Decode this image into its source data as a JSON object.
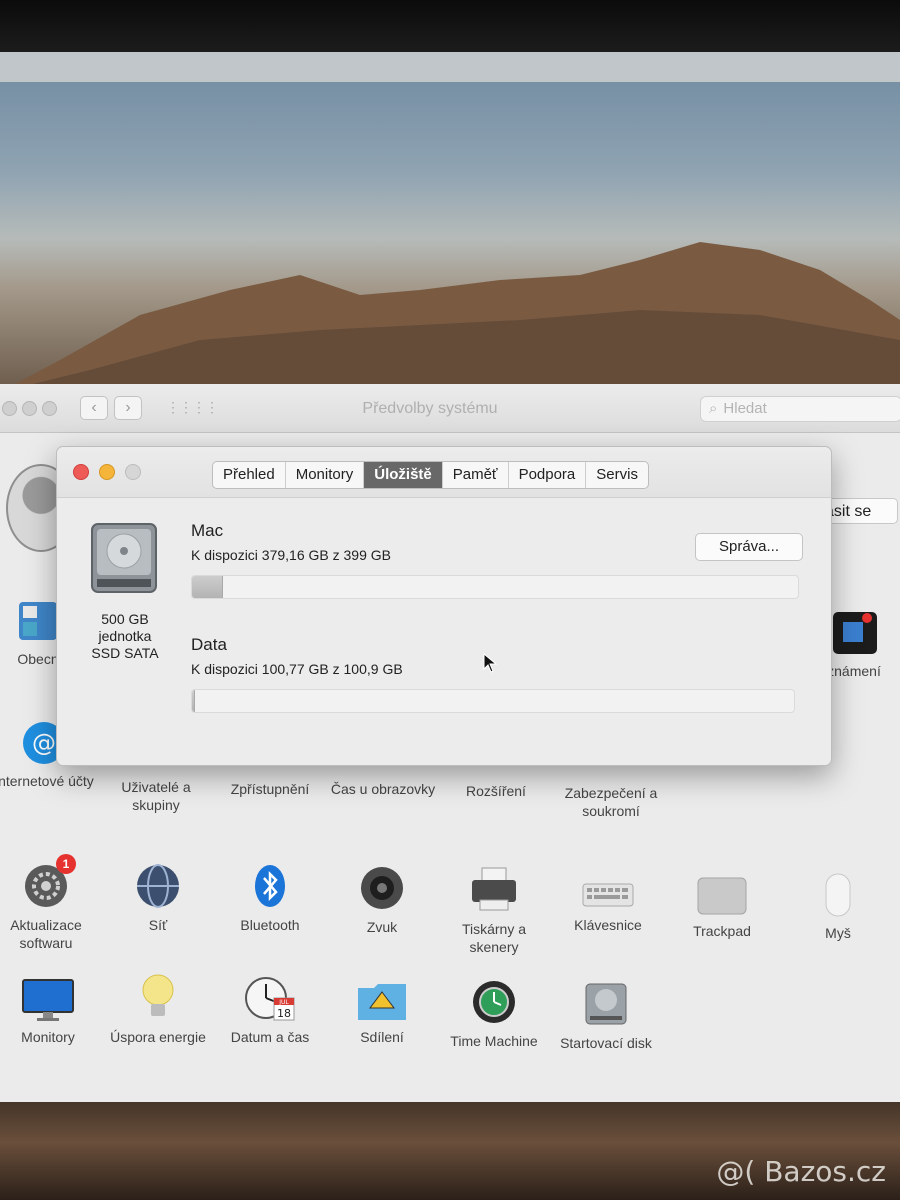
{
  "prefs_window": {
    "title": "Předvolby systému",
    "search_placeholder": "Hledat",
    "sign_in_label": "ásit se",
    "rows": [
      [
        {
          "label": "Obecn",
          "icon": "general-icon"
        },
        {
          "label": "známení",
          "icon": "notifications-icon"
        }
      ],
      [
        {
          "label": "Internetové účty",
          "icon": "internet-accounts-icon"
        },
        {
          "label": "Uživatelé a skupiny",
          "icon": "users-groups-icon"
        },
        {
          "label": "Zpřístupnění",
          "icon": "accessibility-icon"
        },
        {
          "label": "Čas u obrazovky",
          "icon": "screen-time-icon"
        },
        {
          "label": "Rozšíření",
          "icon": "extensions-icon"
        },
        {
          "label": "Zabezpečení a soukromí",
          "icon": "security-privacy-icon"
        }
      ],
      [
        {
          "label": "Aktualizace softwaru",
          "icon": "software-update-icon",
          "badge": "1"
        },
        {
          "label": "Síť",
          "icon": "network-icon"
        },
        {
          "label": "Bluetooth",
          "icon": "bluetooth-icon"
        },
        {
          "label": "Zvuk",
          "icon": "sound-icon"
        },
        {
          "label": "Tiskárny a skenery",
          "icon": "printers-scanners-icon"
        },
        {
          "label": "Klávesnice",
          "icon": "keyboard-icon"
        },
        {
          "label": "Trackpad",
          "icon": "trackpad-icon"
        },
        {
          "label": "Myš",
          "icon": "mouse-icon"
        }
      ],
      [
        {
          "label": "Monitory",
          "icon": "displays-icon"
        },
        {
          "label": "Úspora energie",
          "icon": "energy-saver-icon"
        },
        {
          "label": "Datum a čas",
          "icon": "date-time-icon",
          "calendar_month": "JUL",
          "calendar_day": "18"
        },
        {
          "label": "Sdílení",
          "icon": "sharing-icon"
        },
        {
          "label": "Time Machine",
          "icon": "time-machine-icon"
        },
        {
          "label": "Startovací disk",
          "icon": "startup-disk-icon"
        }
      ]
    ]
  },
  "about_window": {
    "tabs": [
      "Přehled",
      "Monitory",
      "Úložiště",
      "Paměť",
      "Podpora",
      "Servis"
    ],
    "active_tab": "Úložiště",
    "disk": {
      "line1": "500 GB",
      "line2": "jednotka",
      "line3": "SSD SATA",
      "icon": "hard-drive-icon"
    },
    "manage_button": "Správa...",
    "volumes": [
      {
        "name": "Mac",
        "available": "K dispozici 379,16 GB z 399 GB",
        "used_fraction": 0.05
      },
      {
        "name": "Data",
        "available": "K dispozici 100,77 GB z 100,9 GB",
        "used_fraction": 0.003
      }
    ]
  },
  "watermark": "@( Bazos.cz",
  "colors": {
    "close": "#ee5b56",
    "minimize": "#f5b53a",
    "tab_active": "#686868",
    "badge": "#e5322f"
  }
}
